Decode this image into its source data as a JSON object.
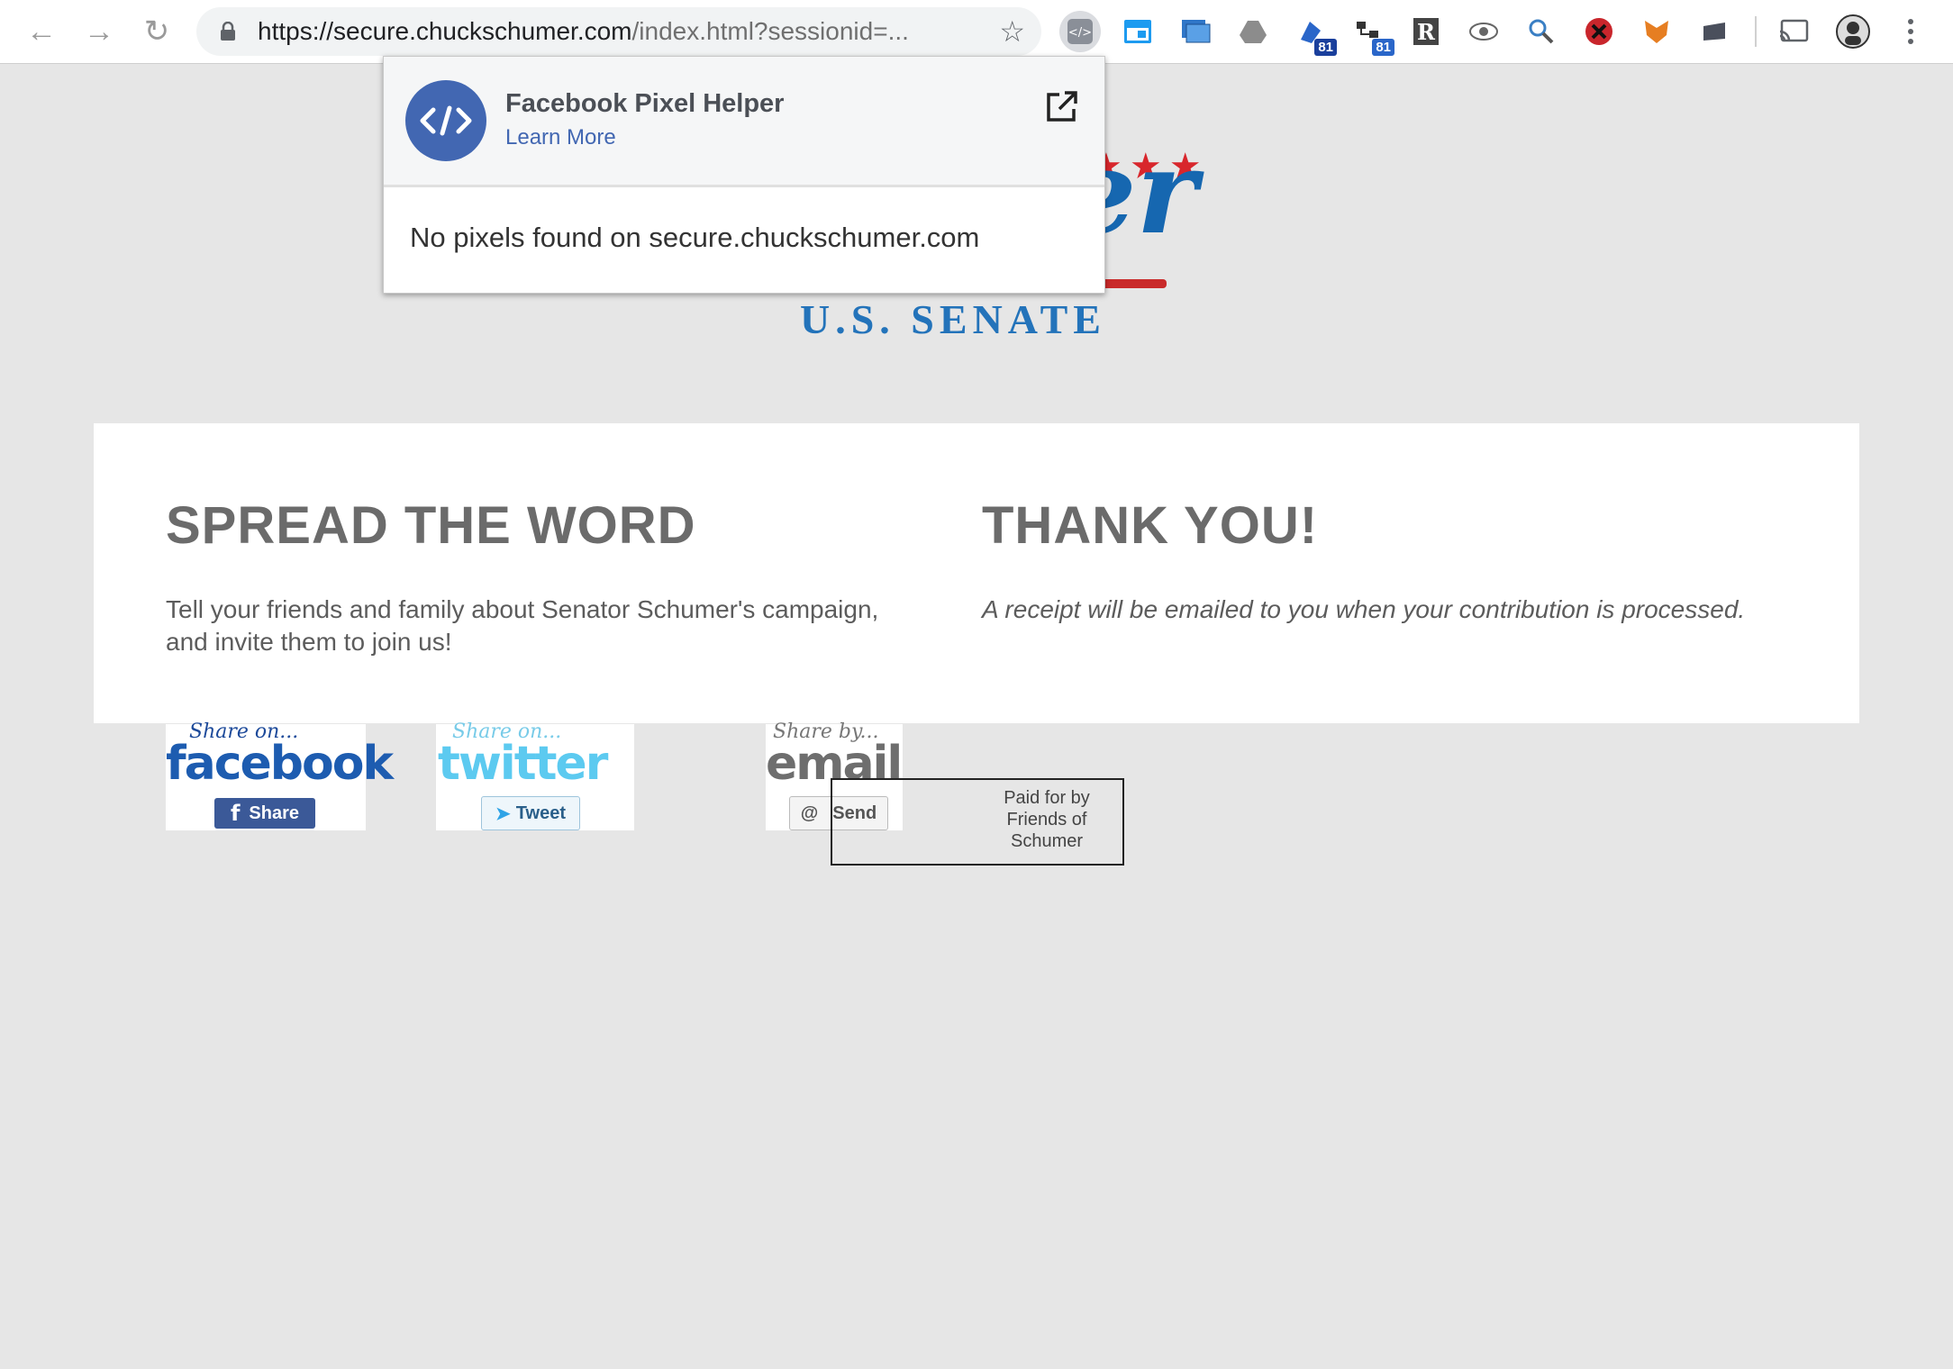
{
  "browser": {
    "url_main": "https://secure.chuckschumer.com",
    "url_rest": "/index.html?sessionid=...",
    "extension_badges": [
      "81",
      "81"
    ]
  },
  "logo": {
    "name_fragment": "er",
    "stars": "★★★",
    "subtitle": "U.S. SENATE"
  },
  "left": {
    "heading": "SPREAD THE WORD",
    "text": "Tell your friends and family about Senator Schumer's campaign, and invite them to join us!"
  },
  "right": {
    "heading": "THANK YOU!",
    "text": "A receipt will be emailed to you when your contribution is processed."
  },
  "share": {
    "facebook": {
      "label": "Share on...",
      "brand": "facebook",
      "button": "Share"
    },
    "twitter": {
      "label": "Share on...",
      "brand": "twitter",
      "button": "Tweet"
    },
    "email": {
      "label": "Share by...",
      "brand": "email",
      "button": "Send"
    }
  },
  "disclaimer": "Paid for by Friends of Schumer",
  "popup": {
    "title": "Facebook Pixel Helper",
    "learn_more": "Learn More",
    "message": "No pixels found on secure.chuckschumer.com"
  },
  "colors": {
    "facebook_blue": "#3b5998",
    "twitter_blue": "#55c7ee",
    "logo_blue": "#1667b0",
    "star_red": "#d8262c"
  }
}
